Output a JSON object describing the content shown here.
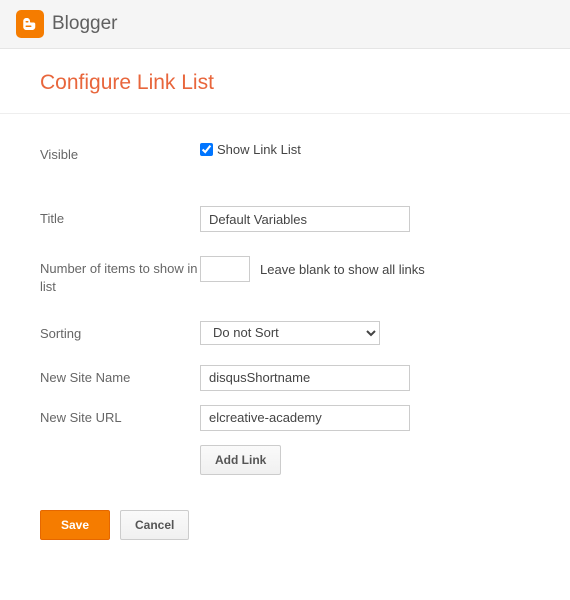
{
  "header": {
    "brand": "Blogger"
  },
  "page": {
    "title": "Configure Link List"
  },
  "form": {
    "visible": {
      "label": "Visible",
      "checkbox_label": "Show Link List",
      "checked": true
    },
    "title": {
      "label": "Title",
      "value": "Default Variables"
    },
    "items_count": {
      "label": "Number of items to show in list",
      "value": "",
      "hint": "Leave blank to show all links"
    },
    "sorting": {
      "label": "Sorting",
      "value": "Do not Sort",
      "options": [
        "Do not Sort"
      ]
    },
    "new_site_name": {
      "label": "New Site Name",
      "value": "disqusShortname"
    },
    "new_site_url": {
      "label": "New Site URL",
      "value": "elcreative-academy"
    },
    "add_link_label": "Add Link"
  },
  "footer": {
    "save": "Save",
    "cancel": "Cancel"
  }
}
